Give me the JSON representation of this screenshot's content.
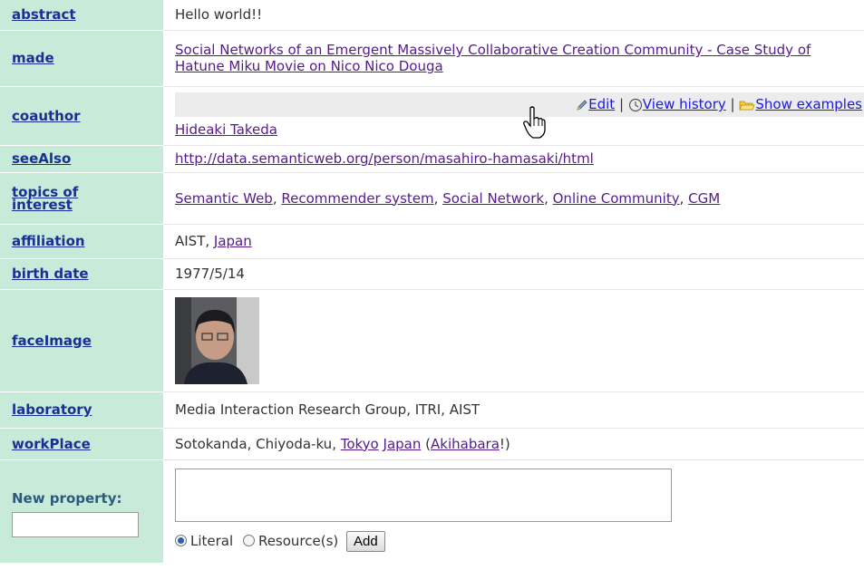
{
  "rows": {
    "abstract": {
      "label": "abstract",
      "value": "Hello world!!"
    },
    "made": {
      "label": "made",
      "value": "Social Networks of an Emergent Massively Collaborative Creation Community - Case Study of Hatune Miku Movie on Nico Nico Douga"
    },
    "coauthor": {
      "label": "coauthor",
      "value": "Hideaki Takeda",
      "tools": {
        "edit": "Edit",
        "sep": "|",
        "history": "View history",
        "examples": "Show examples"
      }
    },
    "seeAlso": {
      "label": "seeAlso",
      "value": "http://data.semanticweb.org/person/masahiro-hamasaki/html"
    },
    "topics": {
      "label": "topics of interest",
      "items": [
        "Semantic Web",
        "Recommender system",
        "Social Network",
        "Online Community",
        "CGM"
      ],
      "sep": ", "
    },
    "affiliation": {
      "label": "affiliation",
      "text": "AIST, ",
      "link": "Japan"
    },
    "birth": {
      "label": "birth date",
      "value": "1977/5/14"
    },
    "faceImage": {
      "label": "faceImage"
    },
    "laboratory": {
      "label": "laboratory",
      "value": "Media Interaction Research Group, ITRI, AIST"
    },
    "workPlace": {
      "label": "workPlace",
      "text": "Sotokanda, Chiyoda-ku, ",
      "link1": "Tokyo",
      "link2": "Japan",
      "paren_open": "(",
      "link3": "Akihabara",
      "paren_close": "!)"
    }
  },
  "new_property": {
    "label": "New property:",
    "literal": "Literal",
    "resource": "Resource(s)",
    "add": "Add",
    "selected": "Literal"
  },
  "colors": {
    "key_bg": "#c8ebd9",
    "link": "#551a8b",
    "prop": "#1a2f96"
  }
}
